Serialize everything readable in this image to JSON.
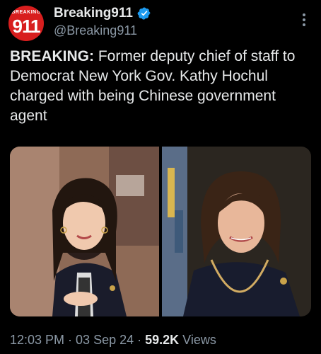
{
  "account": {
    "avatar_banner": "BREAKING",
    "avatar_number": "911",
    "display_name": "Breaking911",
    "handle": "@Breaking911",
    "verified_icon": "verified-badge-icon",
    "brand_color": "#d81e1e",
    "verified_color": "#1d9bf0"
  },
  "tweet": {
    "lead": "BREAKING:",
    "body": " Former deputy chief of staff to Democrat New York Gov. Kathy Hochul charged with being Chinese government agent"
  },
  "media": {
    "photos": [
      {
        "icon": "photo-left-woman-portrait"
      },
      {
        "icon": "photo-right-woman-portrait"
      }
    ]
  },
  "meta": {
    "time": "12:03 PM",
    "sep1": " · ",
    "date": "03 Sep 24",
    "sep2": " · ",
    "views_count": "59.2K",
    "views_label": " Views"
  }
}
